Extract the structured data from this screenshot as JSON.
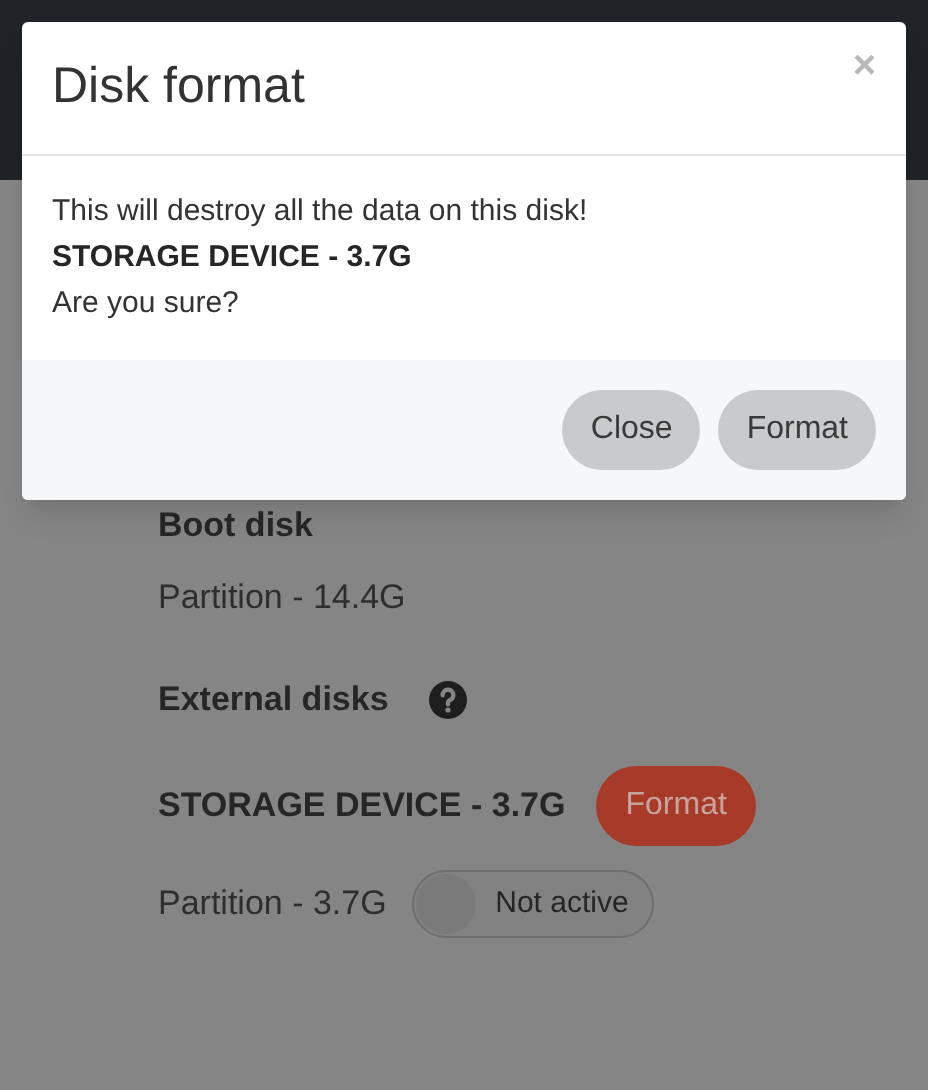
{
  "modal": {
    "title": "Disk format",
    "close_icon": "×",
    "message": "This will destroy all the data on this disk!",
    "device": "STORAGE DEVICE - 3.7G",
    "question": "Are you sure?",
    "buttons": [
      "Close",
      "Format"
    ]
  },
  "page": {
    "boot_disk": {
      "heading": "Boot disk",
      "partitions": [
        {
          "label": "Partition - 14.4G"
        }
      ]
    },
    "external_disks": {
      "heading": "External disks",
      "devices": [
        {
          "name": "STORAGE DEVICE - 3.7G",
          "format_button": "Format",
          "partitions": [
            {
              "label": "Partition - 3.7G",
              "active": false,
              "toggle_label": "Not active"
            }
          ]
        }
      ]
    }
  }
}
